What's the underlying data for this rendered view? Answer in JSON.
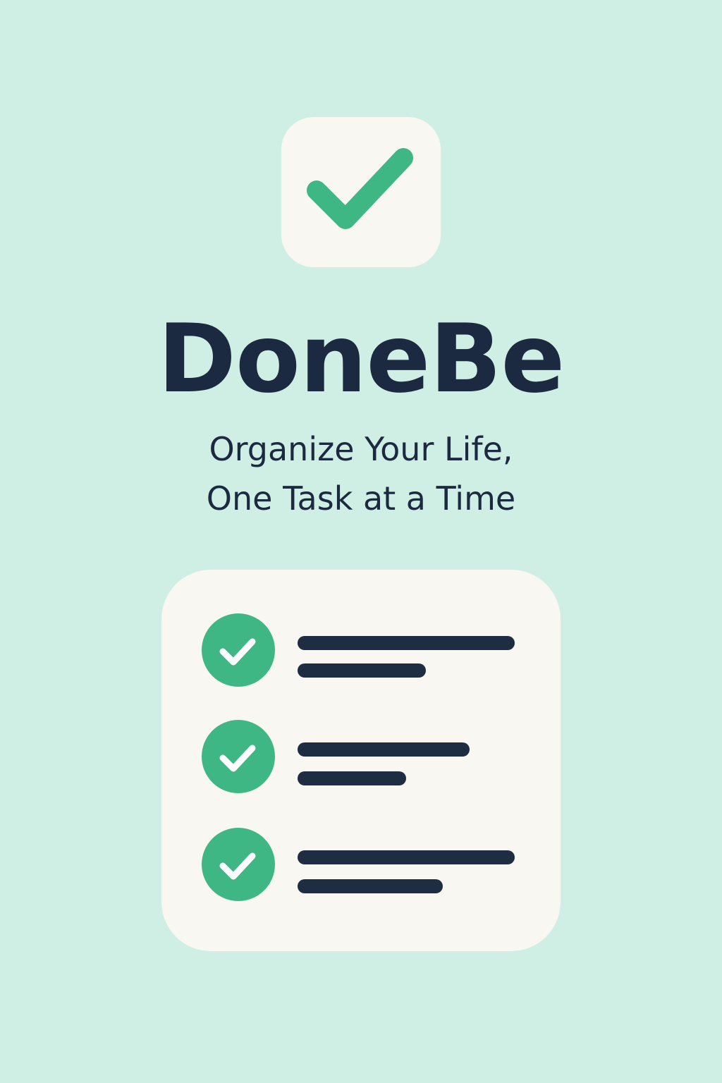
{
  "app": {
    "name": "DoneBe",
    "tagline_lines": [
      "Organize Your Life,",
      "One Task at a Time"
    ]
  },
  "icons": {
    "app_icon": "checkmark-icon",
    "task_icon": "check-circle-icon"
  },
  "checklist": {
    "item_count": 3,
    "items_completed": [
      true,
      true,
      true
    ]
  },
  "colors": {
    "background": "#d0efe4",
    "card": "#f9f7f1",
    "accent_green": "#3fb784",
    "text_dark": "#1b2a40"
  }
}
